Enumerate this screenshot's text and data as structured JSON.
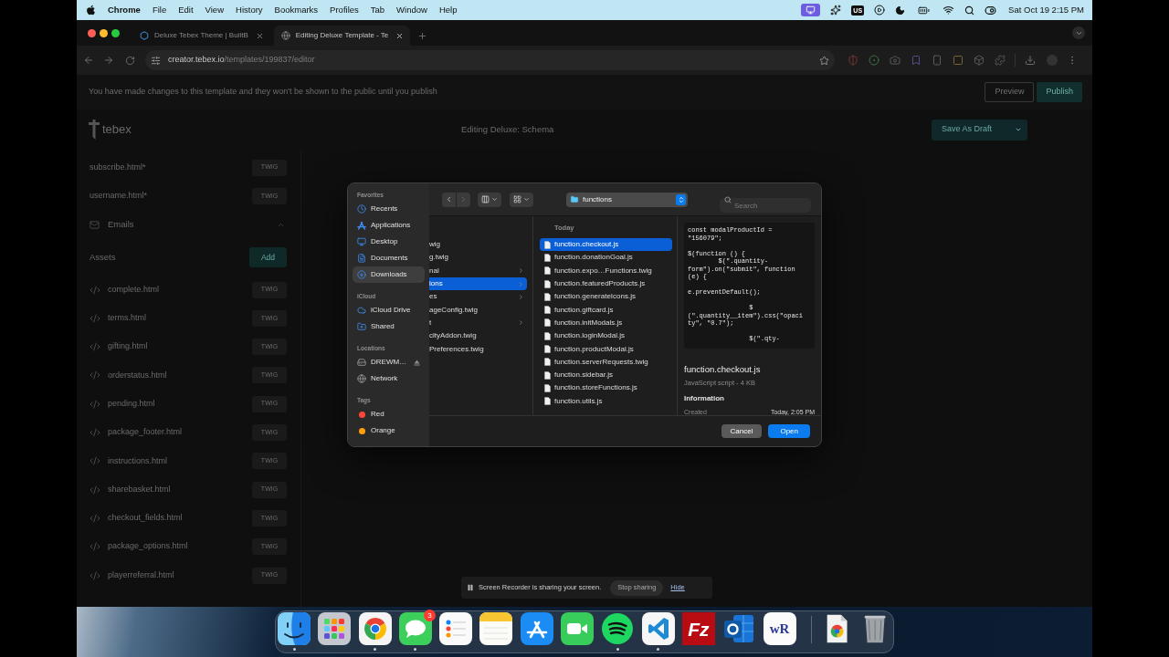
{
  "menu_bar": {
    "app": "Chrome",
    "menus": [
      "File",
      "Edit",
      "View",
      "History",
      "Bookmarks",
      "Profiles",
      "Tab",
      "Window",
      "Help"
    ],
    "input_source": "US",
    "clock": "Sat Oct 19 2:15 PM"
  },
  "browser": {
    "tabs": [
      {
        "title": "Deluxe Tebex Theme | BuiltB",
        "selected": false
      },
      {
        "title": "Editing Deluxe Template - Te",
        "selected": true
      }
    ],
    "url": {
      "domain": "creator.tebex.io",
      "path": "/templates/199837/editor"
    }
  },
  "editor": {
    "notice": "You have made changes to this template and they won't be shown to the public until you publish",
    "notice_actions": [
      {
        "label": "Preview",
        "kind": "outline"
      },
      {
        "label": "Publish",
        "kind": "primary"
      }
    ],
    "logo": "tebex",
    "title": "Editing Deluxe: Schema",
    "save_button": "Save As Draft",
    "sidebar": [
      {
        "kind": "file",
        "name": "subscribe.html*",
        "badge": "TWIG"
      },
      {
        "kind": "file",
        "name": "username.html*",
        "badge": "TWIG"
      },
      {
        "kind": "group",
        "name": "Emails"
      },
      {
        "kind": "section",
        "name": "Assets",
        "action": "Add"
      },
      {
        "kind": "asset",
        "name": "complete.html",
        "badge": "TWIG"
      },
      {
        "kind": "asset",
        "name": "terms.html",
        "badge": "TWIG"
      },
      {
        "kind": "asset",
        "name": "gifting.html",
        "badge": "TWIG"
      },
      {
        "kind": "asset",
        "name": "orderstatus.html",
        "badge": "TWIG"
      },
      {
        "kind": "asset",
        "name": "pending.html",
        "badge": "TWIG"
      },
      {
        "kind": "asset",
        "name": "package_footer.html",
        "badge": "TWIG"
      },
      {
        "kind": "asset",
        "name": "instructions.html",
        "badge": "TWIG"
      },
      {
        "kind": "asset",
        "name": "sharebasket.html",
        "badge": "TWIG"
      },
      {
        "kind": "asset",
        "name": "checkout_fields.html",
        "badge": "TWIG"
      },
      {
        "kind": "asset",
        "name": "package_options.html",
        "badge": "TWIG"
      },
      {
        "kind": "asset",
        "name": "playerreferral.html",
        "badge": "TWIG"
      }
    ]
  },
  "file_dialog": {
    "sidebar": [
      {
        "heading": "Favorites",
        "items": [
          {
            "kind": "recents",
            "label": "Recents",
            "selected": false
          },
          {
            "kind": "applications",
            "label": "Applications",
            "selected": false
          },
          {
            "kind": "desktop",
            "label": "Desktop",
            "selected": false
          },
          {
            "kind": "documents",
            "label": "Documents",
            "selected": false
          },
          {
            "kind": "downloads",
            "label": "Downloads",
            "selected": true
          }
        ]
      },
      {
        "heading": "iCloud",
        "items": [
          {
            "kind": "cloud",
            "label": "iCloud Drive",
            "selected": false
          },
          {
            "kind": "shared",
            "label": "Shared",
            "selected": false
          }
        ]
      },
      {
        "heading": "Locations",
        "items": [
          {
            "kind": "drive",
            "label": "DREWM…",
            "selected": false
          },
          {
            "kind": "network",
            "label": "Network",
            "selected": false
          }
        ]
      },
      {
        "heading": "Tags",
        "items": [
          {
            "kind": "tag",
            "label": "Red",
            "color": "#ff453a",
            "selected": false
          },
          {
            "kind": "tag",
            "label": "Orange",
            "color": "#ff9f0a",
            "selected": false
          }
        ]
      }
    ],
    "location": "functions",
    "search_placeholder": "Search",
    "columns": [
      {
        "items": [
          {
            "name": "wig",
            "folder": false,
            "selected": false
          },
          {
            "name": "g.twig",
            "folder": false,
            "selected": false
          },
          {
            "name": "nal",
            "folder": true,
            "selected": false
          },
          {
            "name": "ions",
            "folder": true,
            "selected": true
          },
          {
            "name": "es",
            "folder": true,
            "selected": false
          },
          {
            "name": "ageConfig.twig",
            "folder": false,
            "selected": false
          },
          {
            "name": "t",
            "folder": true,
            "selected": false
          },
          {
            "name": "cityAddon.twig",
            "folder": false,
            "selected": false
          },
          {
            "name": "Preferences.twig",
            "folder": false,
            "selected": false
          }
        ]
      },
      {
        "heading": "Today",
        "items": [
          {
            "name": "function.checkout.js",
            "selected": true
          },
          {
            "name": "function.donationGoal.js",
            "selected": false
          },
          {
            "name": "function.expo…Functions.twig",
            "selected": false
          },
          {
            "name": "function.featuredProducts.js",
            "selected": false
          },
          {
            "name": "function.generateIcons.js",
            "selected": false
          },
          {
            "name": "function.giftcard.js",
            "selected": false
          },
          {
            "name": "function.initModals.js",
            "selected": false
          },
          {
            "name": "function.loginModal.js",
            "selected": false
          },
          {
            "name": "function.productModal.js",
            "selected": false
          },
          {
            "name": "function.serverRequests.twig",
            "selected": false
          },
          {
            "name": "function.sidebar.js",
            "selected": false
          },
          {
            "name": "function.storeFunctions.js",
            "selected": false
          },
          {
            "name": "function.utils.js",
            "selected": false
          }
        ]
      }
    ],
    "preview": {
      "code": "const modalProductId =\n\"156079\";\n\n$(function () {\n        $(\".quantity-\nform\").on(\"submit\", function\n(e) {\n\ne.preventDefault();\n\n                $\n(\".quantity__item\").css(\"opaci\nty\", \"0.7\");\n\n                $(\".qty-",
      "name": "function.checkout.js",
      "type": "JavaScript script - 4 KB",
      "heading": "Information",
      "rows": [
        {
          "label": "Created",
          "value": "Today, 2:05 PM"
        }
      ]
    },
    "buttons": [
      {
        "label": "Cancel",
        "kind": "secondary"
      },
      {
        "label": "Open",
        "kind": "primary"
      }
    ]
  },
  "share_bar": {
    "message": "Screen Recorder is sharing your screen.",
    "stop_button": "Stop sharing",
    "hide_link": "Hide"
  },
  "dock": {
    "apps": [
      {
        "kind": "finder",
        "running": true
      },
      {
        "kind": "launchpad",
        "running": false
      },
      {
        "kind": "chrome",
        "running": true
      },
      {
        "kind": "messages",
        "running": true,
        "badge": "3"
      },
      {
        "kind": "reminders",
        "running": false
      },
      {
        "kind": "notes",
        "running": false
      },
      {
        "kind": "app_store",
        "running": false
      },
      {
        "kind": "facetime",
        "running": false
      },
      {
        "kind": "spotify",
        "running": true
      },
      {
        "kind": "vscode",
        "running": true
      },
      {
        "kind": "filezilla",
        "running": false,
        "logo_text": "Fz"
      },
      {
        "kind": "outlook",
        "running": false
      },
      {
        "kind": "wordreference",
        "running": false,
        "logo_text": "wR"
      }
    ]
  }
}
